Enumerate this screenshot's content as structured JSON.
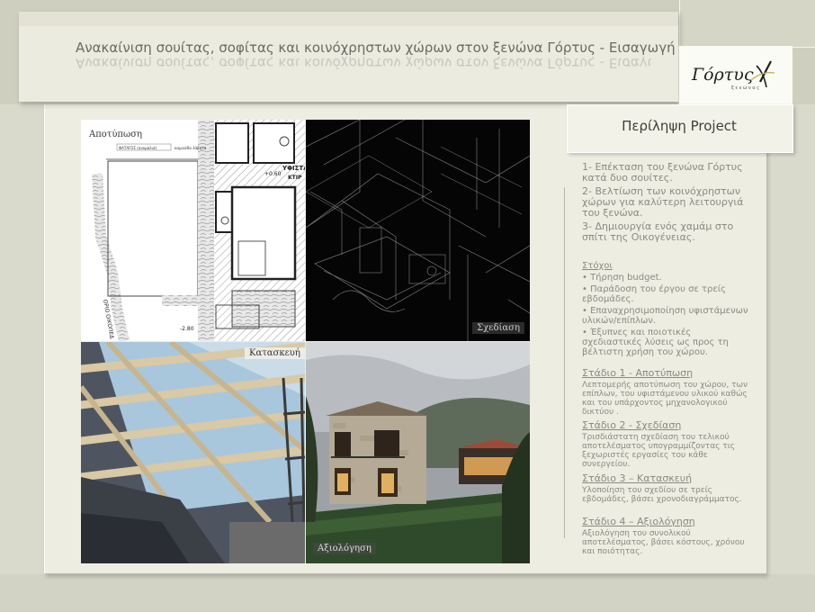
{
  "title": "Ανακαίνιση σουίτας, σοφίτας και κοινόχρηστων χώρων  στον ξενώνα Γόρτυς -  Εισαγωγή",
  "logo": {
    "text": "Γόρτυς",
    "subtext": "ξ ε ν ώ ν α ς"
  },
  "summary_title": "Περίληψη Project",
  "images": {
    "survey_label": "Αποτύπωση",
    "survey_marks": {
      "facade": "ΦΑΤΑΓΟΣ (ανομαλιά)",
      "drainage": "καμινάδα λάβητα",
      "floor": "ΥΦΙΣΤΑ",
      "building": "ΚΤΙΡ",
      "level_top": "+0.60",
      "level_bottom": "-2.80",
      "plot": "ΟΡΙΟ ΟΙΚΟΠΕΔ"
    },
    "design_label": "Σχεδίαση",
    "construction_label": "Κατασκευή",
    "evaluation_label": "Αξιολόγηση"
  },
  "intro": [
    "1- Επέκταση  του ξενώνα Γόρτυς κατά δυο σουίτες.",
    "2- Βελτίωση των κοινόχρηστων χώρων για καλύτερη λειτουργιά του ξενώνα.",
    "3- Δημιουργία ενός χαμάμ στο σπίτι της Οικογένειας."
  ],
  "goals": {
    "heading": "Στόχοι",
    "items": [
      "• Τήρηση budget.",
      "• Παράδοση του έργου σε τρείς εβδομάδες.",
      "• Επαναχρησιμοποίηση  υφιστάμενων υλικών/επίπλων.",
      "• Έξυπνες και ποιοτικές  σχεδιαστικές λύσεις ως προς τη βέλτιστη χρήση του χώρου."
    ]
  },
  "stages": [
    {
      "heading": "Στάδιο 1 - Αποτύπωση",
      "text": "Λεπτομερής αποτύπωση του χώρου, των επίπλων, του υφιστάμενου υλικού καθώς και του υπάρχοντος μηχανολογικού δικτύου ."
    },
    {
      "heading": "Στάδιο 2 - Σχεδίαση",
      "text": "Τρισδιάστατη σχεδίαση του τελικού αποτελέσματος υπογραμμίζοντας τις ξεχωριστές εργασίες του κάθε συνεργείου."
    },
    {
      "heading": "Στάδιο 3 – Κατασκευή",
      "text": "Υλοποίηση του σχεδίου σε τρείς εβδομάδες, βάσει χρονοδιαγράμματος."
    },
    {
      "heading": "Στάδιο 4 – Αξιολόγηση",
      "text": "Αξιολόγηση του συνολικού αποτελέσματος, βάσει κόστους, χρόνου και ποιότητας."
    }
  ]
}
